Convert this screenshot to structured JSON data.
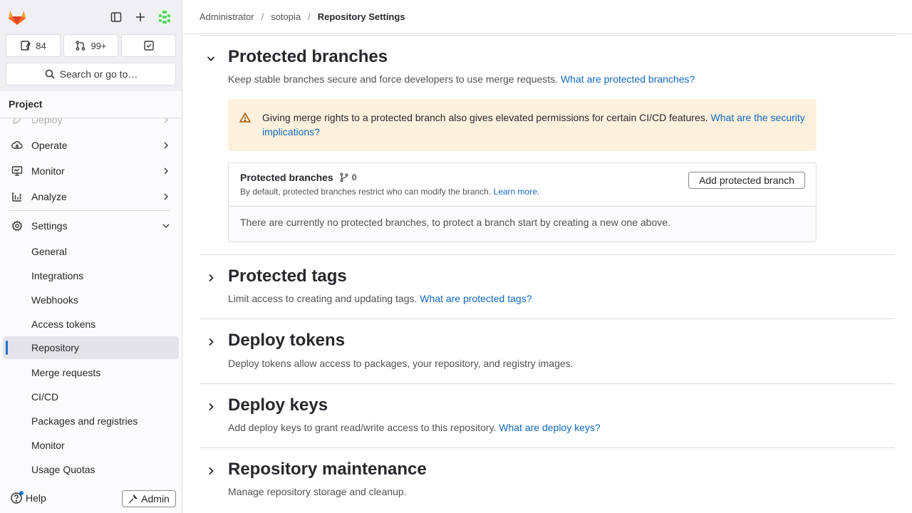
{
  "sidebar": {
    "counts": {
      "issues": "84",
      "merge_requests": "99+"
    },
    "search_label": "Search or go to…",
    "project_header": "Project",
    "nav": [
      {
        "label": "Deploy"
      },
      {
        "label": "Operate"
      },
      {
        "label": "Monitor"
      },
      {
        "label": "Analyze"
      },
      {
        "label": "Settings"
      }
    ],
    "settings_items": [
      {
        "label": "General"
      },
      {
        "label": "Integrations"
      },
      {
        "label": "Webhooks"
      },
      {
        "label": "Access tokens"
      },
      {
        "label": "Repository"
      },
      {
        "label": "Merge requests"
      },
      {
        "label": "CI/CD"
      },
      {
        "label": "Packages and registries"
      },
      {
        "label": "Monitor"
      },
      {
        "label": "Usage Quotas"
      }
    ],
    "help_label": "Help",
    "admin_label": "Admin"
  },
  "breadcrumb": {
    "items": [
      "Administrator",
      "sotopia"
    ],
    "current": "Repository Settings"
  },
  "protected_branches": {
    "title": "Protected branches",
    "description": "Keep stable branches secure and force developers to use merge requests.",
    "description_link": "What are protected branches?",
    "alert_text": "Giving merge rights to a protected branch also gives elevated permissions for certain CI/CD features.",
    "alert_link": "What are the security implications?",
    "card_title": "Protected branches",
    "card_count": "0",
    "card_sub": "By default, protected branches restrict who can modify the branch.",
    "card_sub_link": "Learn more",
    "add_button": "Add protected branch",
    "empty_text": "There are currently no protected branches, to protect a branch start by creating a new one above."
  },
  "protected_tags": {
    "title": "Protected tags",
    "description": "Limit access to creating and updating tags.",
    "description_link": "What are protected tags?"
  },
  "deploy_tokens": {
    "title": "Deploy tokens",
    "description": "Deploy tokens allow access to packages, your repository, and registry images."
  },
  "deploy_keys": {
    "title": "Deploy keys",
    "description": "Add deploy keys to grant read/write access to this repository.",
    "description_link": "What are deploy keys?"
  },
  "repository_maintenance": {
    "title": "Repository maintenance",
    "description": "Manage repository storage and cleanup."
  },
  "colors": {
    "accent": "#1f75cb",
    "link": "#1068bf",
    "alert_bg": "#fdf1dd",
    "warning_icon": "#9e5400"
  }
}
